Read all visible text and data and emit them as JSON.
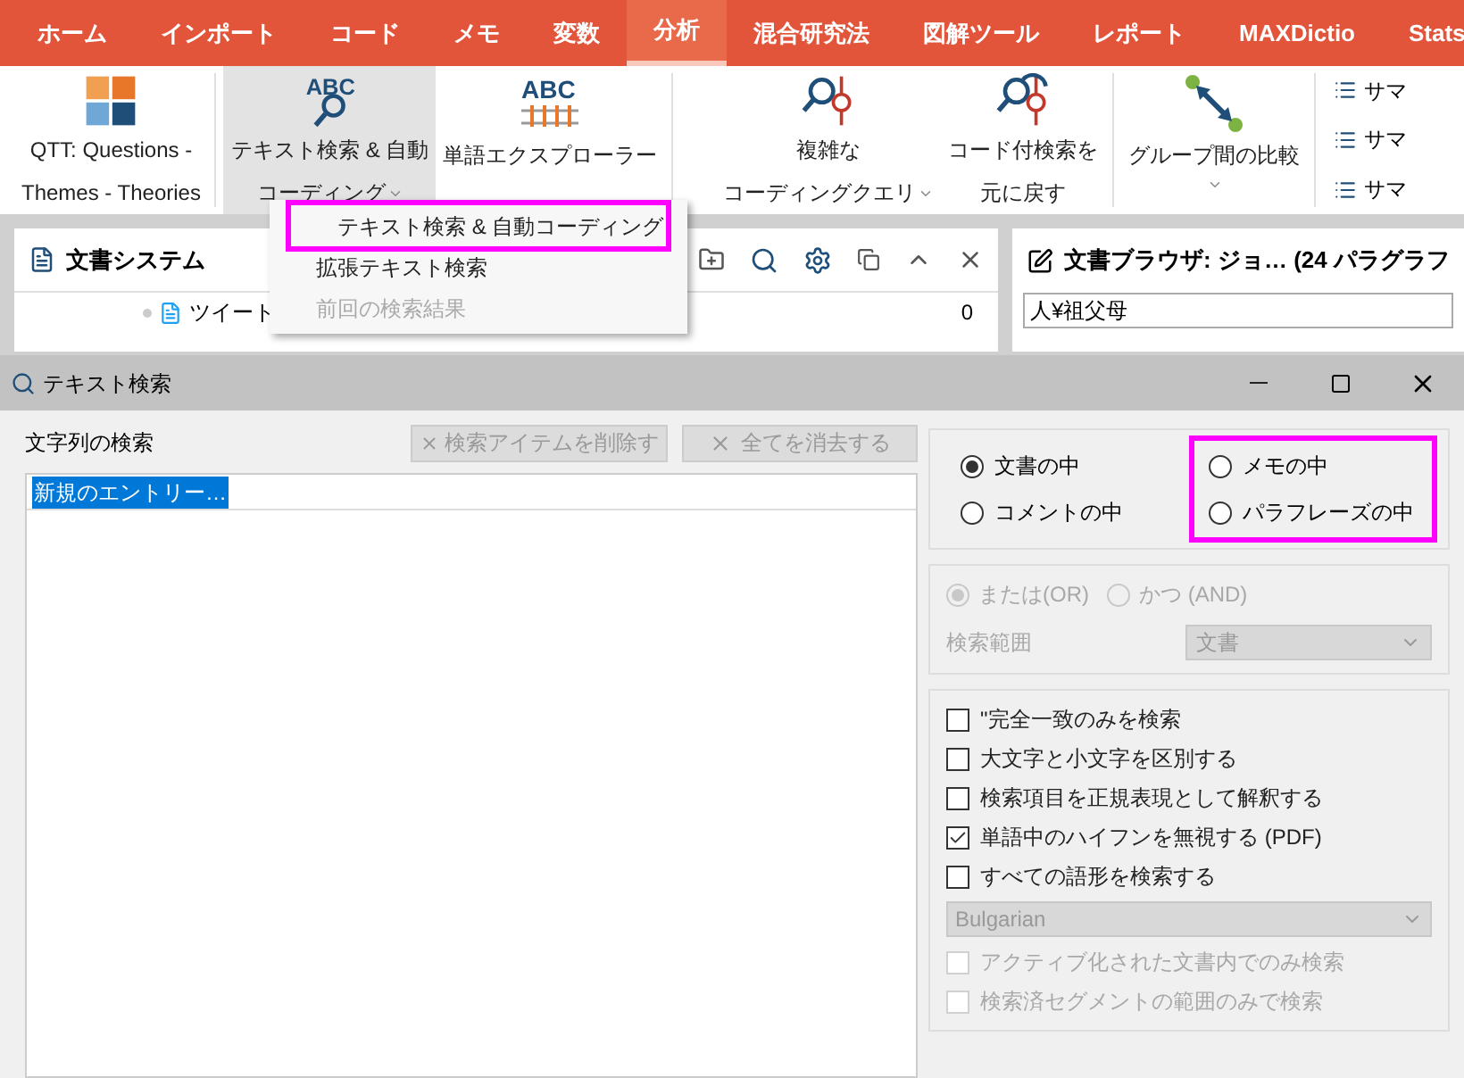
{
  "menu_tabs": [
    {
      "label": "ホーム",
      "selected": false
    },
    {
      "label": "インポート",
      "selected": false
    },
    {
      "label": "コード",
      "selected": false
    },
    {
      "label": "メモ",
      "selected": false
    },
    {
      "label": "変数",
      "selected": false
    },
    {
      "label": "分析",
      "selected": true
    },
    {
      "label": "混合研究法",
      "selected": false
    },
    {
      "label": "図解ツール",
      "selected": false
    },
    {
      "label": "レポート",
      "selected": false
    },
    {
      "label": "MAXDictio",
      "selected": false
    },
    {
      "label": "Stats",
      "selected": false
    }
  ],
  "ribbon": [
    {
      "kind": "puzzle",
      "lines": [
        "QTT: Questions -",
        "Themes - Theories"
      ],
      "dropdown": false,
      "selected": false
    },
    {
      "kind": "abc-search",
      "icon_text": "ABC",
      "lines": [
        "テキスト検索 & 自動",
        "コーディング"
      ],
      "dropdown": true,
      "selected": true
    },
    {
      "kind": "abc-ruler",
      "icon_text": "ABC",
      "lines": [
        "単語エクスプローラー"
      ],
      "dropdown": false,
      "selected": false
    },
    {
      "kind": "query",
      "lines": [
        "複雑な",
        "コーディングクエリ"
      ],
      "dropdown": true,
      "selected": false
    },
    {
      "kind": "undo-query",
      "lines": [
        "コード付検索を",
        "元に戻す"
      ],
      "dropdown": false,
      "selected": false
    },
    {
      "kind": "compare",
      "lines": [
        "グループ間の比較"
      ],
      "dropdown": true,
      "selected": false
    }
  ],
  "ribbon_small": [
    "サマ",
    "サマ",
    "サマ"
  ],
  "dropdown_menu": [
    {
      "label": "テキスト検索 & 自動コーディング",
      "disabled": false,
      "highlighted": true
    },
    {
      "label": "拡張テキスト検索",
      "disabled": false,
      "highlighted": false
    },
    {
      "label": "前回の検索結果",
      "disabled": true,
      "highlighted": false
    }
  ],
  "document_system": {
    "title": "文書システム",
    "row_label": "ツイート",
    "row_count": "0"
  },
  "document_browser": {
    "title": "文書ブラウザ: ジョ… (24 パラグラフ",
    "field_value": "人¥祖父母"
  },
  "dialog": {
    "title": "テキスト検索",
    "search_label": "文字列の検索",
    "delete_button": {
      "label": "検索アイテムを削除す",
      "disabled": true
    },
    "clear_button": {
      "label": "全てを消去する",
      "disabled": true
    },
    "entries": [
      {
        "text": "新規のエントリー…",
        "selected": true
      }
    ],
    "scope_columns": [
      {
        "options": [
          {
            "label": "文書の中",
            "selected": true
          },
          {
            "label": "コメントの中",
            "selected": false
          }
        ]
      },
      {
        "highlighted": true,
        "options": [
          {
            "label": "メモの中",
            "selected": false
          },
          {
            "label": "パラフレーズの中",
            "selected": false
          }
        ]
      }
    ],
    "logic_options": [
      {
        "label": "または(OR)",
        "selected": true
      },
      {
        "label": "かつ (AND)",
        "selected": false
      }
    ],
    "range_label": "検索範囲",
    "range_value": "文書",
    "checkboxes": [
      {
        "label": "\"完全一致のみを検索",
        "checked": false,
        "disabled": false
      },
      {
        "label": "大文字と小文字を区別する",
        "checked": false,
        "disabled": false
      },
      {
        "label": "検索項目を正規表現として解釈する",
        "checked": false,
        "disabled": false
      },
      {
        "label": "単語中のハイフンを無視する (PDF)",
        "checked": true,
        "disabled": false
      },
      {
        "label": "すべての語形を検索する",
        "checked": false,
        "disabled": false
      }
    ],
    "language_value": "Bulgarian",
    "extra_checkboxes": [
      {
        "label": "アクティブ化された文書内でのみ検索",
        "checked": false,
        "disabled": true
      },
      {
        "label": "検索済セグメントの範囲のみで検索",
        "checked": false,
        "disabled": true
      }
    ]
  }
}
